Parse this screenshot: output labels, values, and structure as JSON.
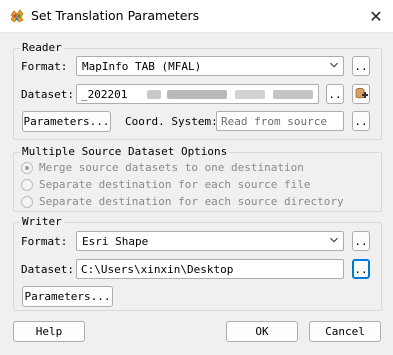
{
  "window": {
    "title": "Set Translation Parameters",
    "close_glyph": "✕",
    "app_icon": "fme-workbench-icon"
  },
  "reader": {
    "section_label": "Reader",
    "format_label": "Format:",
    "format_value": "MapInfo TAB (MFAL)",
    "dataset_label": "Dataset:",
    "dataset_value": "_202201",
    "parameters_label": "Parameters...",
    "coord_label": "Coord. System:",
    "coord_placeholder": "Read from source",
    "browse_label": ".."
  },
  "multiple": {
    "section_label": "Multiple Source Dataset Options",
    "options": [
      {
        "label": "Merge source datasets to one destination",
        "checked": true
      },
      {
        "label": "Separate destination for each source file",
        "checked": false
      },
      {
        "label": "Separate destination for each source directory",
        "checked": false
      }
    ]
  },
  "writer": {
    "section_label": "Writer",
    "format_label": "Format:",
    "format_value": "Esri Shape",
    "dataset_label": "Dataset:",
    "dataset_value": "C:\\Users\\xinxin\\Desktop",
    "parameters_label": "Parameters...",
    "browse_label": ".."
  },
  "footer": {
    "help_label": "Help",
    "ok_label": "OK",
    "cancel_label": "Cancel"
  },
  "colors": {
    "focus_border": "#0078d4",
    "dialog_bg": "#f0f0f0"
  }
}
